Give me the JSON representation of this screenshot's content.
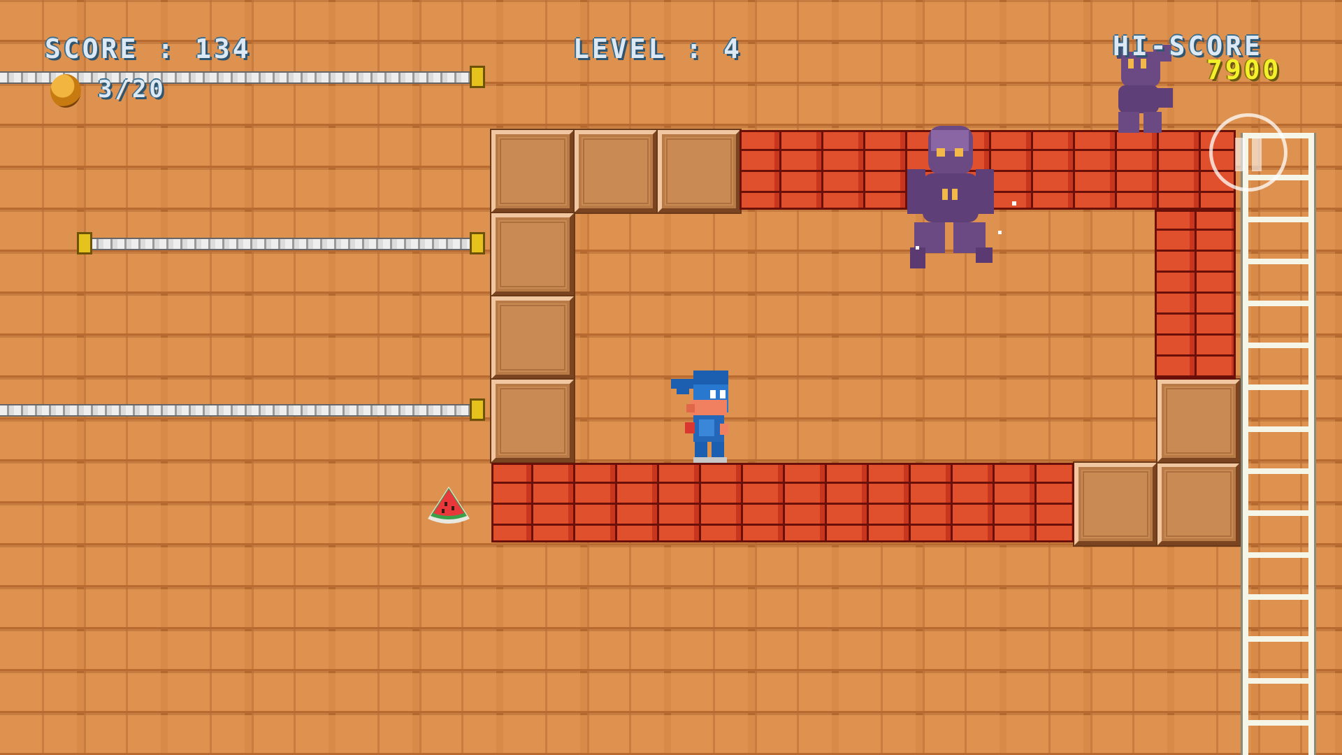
{
  "hud": {
    "score_label": "SCORE : 134",
    "coin_count": "3/20",
    "level_label": "LEVEL : 4",
    "hi_score_label": "HI-SCORE",
    "hi_score_value": "7900"
  },
  "icons": {
    "coin": "coin-icon",
    "pause": "pause-icon",
    "player": "ninja-player",
    "enemy": "purple-ghoul-enemy",
    "pickup": "watermelon-slice"
  },
  "colors": {
    "hud_text": "#dce9f5",
    "hi_score_value": "#f4f02a",
    "background_brick": "#d88a48",
    "red_brick": "#b8281c",
    "block": "#c98a54"
  }
}
